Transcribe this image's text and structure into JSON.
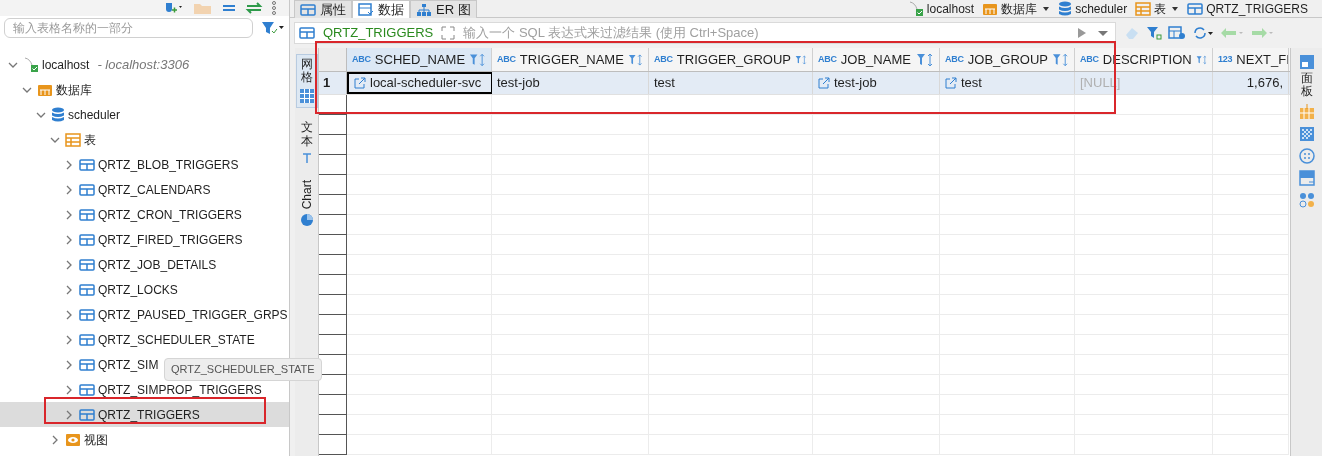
{
  "search": {
    "placeholder": "输入表格名称的一部分"
  },
  "tree": [
    {
      "label": "localhost",
      "detail": "- localhost:3306",
      "kind": "connection",
      "expanded": true,
      "selected": false,
      "children": [
        {
          "label": "数据库",
          "kind": "folder",
          "expanded": true,
          "selected": false,
          "children": [
            {
              "label": "scheduler",
              "kind": "database",
              "expanded": true,
              "selected": false,
              "children": [
                {
                  "label": "表",
                  "kind": "tables",
                  "expanded": true,
                  "selected": false,
                  "children": [
                    {
                      "label": "QRTZ_BLOB_TRIGGERS",
                      "kind": "table",
                      "expanded": false,
                      "selected": false
                    },
                    {
                      "label": "QRTZ_CALENDARS",
                      "kind": "table",
                      "expanded": false,
                      "selected": false
                    },
                    {
                      "label": "QRTZ_CRON_TRIGGERS",
                      "kind": "table",
                      "expanded": false,
                      "selected": false
                    },
                    {
                      "label": "QRTZ_FIRED_TRIGGERS",
                      "kind": "table",
                      "expanded": false,
                      "selected": false
                    },
                    {
                      "label": "QRTZ_JOB_DETAILS",
                      "kind": "table",
                      "expanded": false,
                      "selected": false
                    },
                    {
                      "label": "QRTZ_LOCKS",
                      "kind": "table",
                      "expanded": false,
                      "selected": false
                    },
                    {
                      "label": "QRTZ_PAUSED_TRIGGER_GRPS",
                      "kind": "table",
                      "expanded": false,
                      "selected": false
                    },
                    {
                      "label": "QRTZ_SCHEDULER_STATE",
                      "kind": "table",
                      "expanded": false,
                      "selected": false
                    },
                    {
                      "label": "QRTZ_SIM",
                      "kind": "table",
                      "expanded": false,
                      "selected": false
                    },
                    {
                      "label": "QRTZ_SIMPROP_TRIGGERS",
                      "kind": "table",
                      "expanded": false,
                      "selected": false
                    },
                    {
                      "label": "QRTZ_TRIGGERS",
                      "kind": "table",
                      "expanded": false,
                      "selected": true
                    }
                  ]
                },
                {
                  "label": "视图",
                  "kind": "views",
                  "expanded": false,
                  "selected": false
                }
              ]
            }
          ]
        }
      ]
    }
  ],
  "tooltip": "QRTZ_SCHEDULER_STATE",
  "editor_tabs": [
    {
      "label": "属性",
      "kind": "properties",
      "selected": false
    },
    {
      "label": "数据",
      "kind": "data",
      "selected": true
    },
    {
      "label": "ER 图",
      "kind": "er",
      "selected": false
    }
  ],
  "breadcrumb": [
    {
      "label": "localhost",
      "kind": "connection",
      "dropdown": false
    },
    {
      "label": "数据库",
      "kind": "folder",
      "dropdown": true
    },
    {
      "label": "scheduler",
      "kind": "database",
      "dropdown": false
    },
    {
      "label": "表",
      "kind": "tables",
      "dropdown": true
    },
    {
      "label": "QRTZ_TRIGGERS",
      "kind": "table",
      "dropdown": false
    }
  ],
  "filter": {
    "table": "QRTZ_TRIGGERS",
    "placeholder": "输入一个 SQL 表达式来过滤结果 (使用 Ctrl+Space)"
  },
  "view_tabs": [
    {
      "label": "网格",
      "kind": "grid",
      "selected": true
    },
    {
      "label": "文本",
      "kind": "text",
      "selected": false
    },
    {
      "label": "Chart",
      "kind": "chart",
      "selected": false
    }
  ],
  "side_panel": {
    "label": "面板"
  },
  "grid": {
    "columns": [
      {
        "name": "SCHED_NAME",
        "type_mark": "ABC",
        "selected": true
      },
      {
        "name": "TRIGGER_NAME",
        "type_mark": "ABC",
        "selected": false
      },
      {
        "name": "TRIGGER_GROUP",
        "type_mark": "ABC",
        "selected": false
      },
      {
        "name": "JOB_NAME",
        "type_mark": "ABC",
        "selected": false
      },
      {
        "name": "JOB_GROUP",
        "type_mark": "ABC",
        "selected": false
      },
      {
        "name": "DESCRIPTION",
        "type_mark": "ABC",
        "selected": false
      },
      {
        "name": "NEXT_FI",
        "type_mark": "123",
        "selected": false
      }
    ],
    "rows": [
      {
        "number": "1",
        "cells": [
          {
            "text": "local-scheduler-svc",
            "kind": "link",
            "focused": true
          },
          {
            "text": "test-job",
            "kind": "text",
            "focused": false
          },
          {
            "text": "test",
            "kind": "text",
            "focused": false
          },
          {
            "text": "test-job",
            "kind": "link",
            "focused": false
          },
          {
            "text": "test",
            "kind": "link",
            "focused": false
          },
          {
            "text": "[NULL]",
            "kind": "null",
            "focused": false
          },
          {
            "text": "1,676,",
            "kind": "number",
            "focused": false
          }
        ]
      }
    ]
  }
}
